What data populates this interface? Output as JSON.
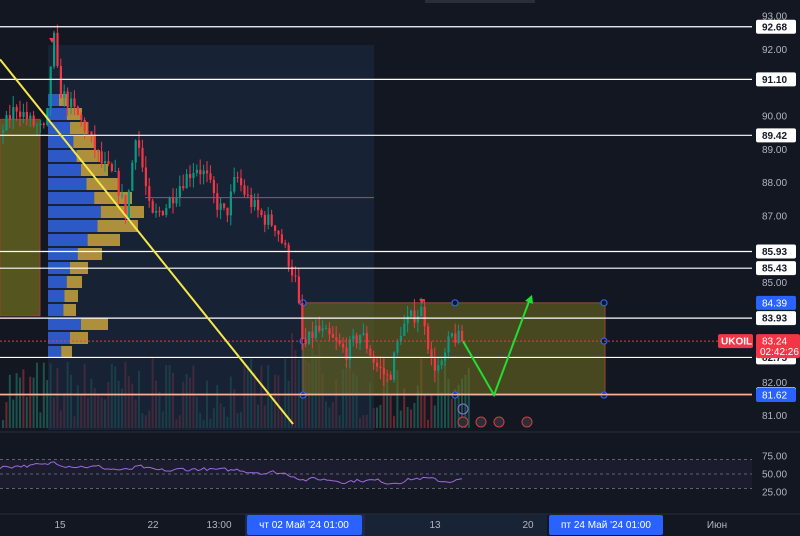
{
  "chart_data": {
    "type": "candlestick",
    "symbol": "UKOIL",
    "last_price": "83.24",
    "countdown": "02:42:26",
    "price_axis": {
      "ticks": [
        "93.00",
        "92.00",
        "90.00",
        "89.00",
        "88.00",
        "87.00",
        "85.00",
        "82.00",
        "81.00"
      ],
      "range": [
        80.6,
        93.2
      ]
    },
    "levels": [
      {
        "value": "92.68",
        "style": "white"
      },
      {
        "value": "91.10",
        "style": "white"
      },
      {
        "value": "89.42",
        "style": "white"
      },
      {
        "value": "85.93",
        "style": "white"
      },
      {
        "value": "85.43",
        "style": "white"
      },
      {
        "value": "84.39",
        "style": "blue"
      },
      {
        "value": "83.93",
        "style": "white"
      },
      {
        "value": "82.75",
        "style": "white"
      },
      {
        "value": "81.64",
        "style": "white"
      },
      {
        "value": "81.62",
        "style": "blue"
      }
    ],
    "rsi": {
      "ticks": [
        "75.00",
        "50.00",
        "25.00"
      ],
      "range": [
        0,
        100
      ],
      "upper": 70,
      "lower": 30
    },
    "time_axis": {
      "labels": [
        "15",
        "22",
        "13:00",
        "13",
        "20",
        "Июн"
      ],
      "highlight_start": "чт 02 Май '24   01:00",
      "highlight_end": "пт 24 Май '24   01:00"
    },
    "projection": {
      "from": 83.24,
      "low": 81.62,
      "target": 84.39
    }
  },
  "colors": {
    "background": "#131722",
    "up": "#089981",
    "down": "#f23645",
    "level_line": "#ffffff",
    "accent_blue": "#2962ff",
    "trendline": "#f5e74a",
    "zone": "#6b6a1f",
    "projection": "#22dd33",
    "price_tag": "#f23645"
  }
}
